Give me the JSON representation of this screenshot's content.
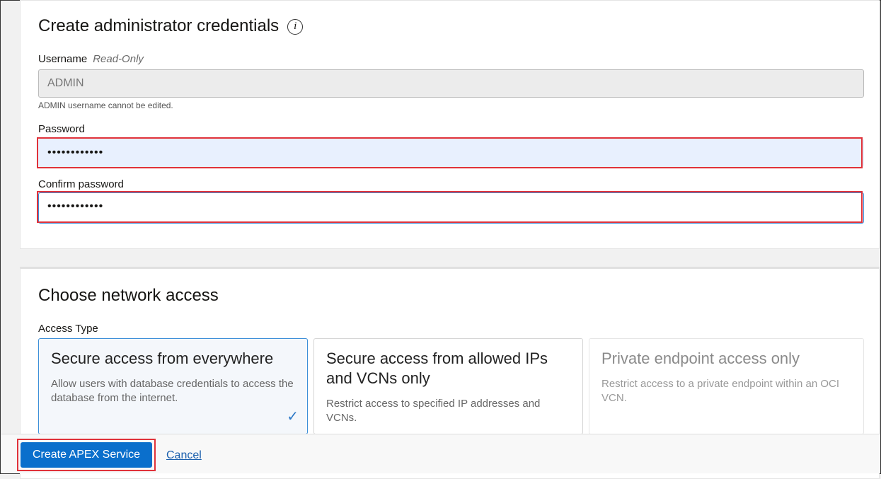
{
  "credentials": {
    "title": "Create administrator credentials",
    "username_label": "Username",
    "read_only": "Read-Only",
    "username_value": "ADMIN",
    "username_hint": "ADMIN username cannot be edited.",
    "password_label": "Password",
    "password_value": "••••••••••••",
    "confirm_label": "Confirm password",
    "confirm_value": "••••••••••••"
  },
  "network": {
    "title": "Choose network access",
    "access_type_label": "Access Type",
    "options": [
      {
        "title": "Secure access from everywhere",
        "desc": "Allow users with database credentials to access the database from the internet.",
        "selected": true
      },
      {
        "title": "Secure access from allowed IPs and VCNs only",
        "desc": "Restrict access to specified IP addresses and VCNs.",
        "selected": false
      },
      {
        "title": "Private endpoint access only",
        "desc": "Restrict access to a private endpoint within an OCI VCN.",
        "selected": false,
        "disabled": true
      }
    ]
  },
  "footer": {
    "create_label": "Create APEX Service",
    "cancel_label": "Cancel"
  },
  "colors": {
    "primary": "#0a6fcc",
    "highlight": "#e0323a"
  }
}
